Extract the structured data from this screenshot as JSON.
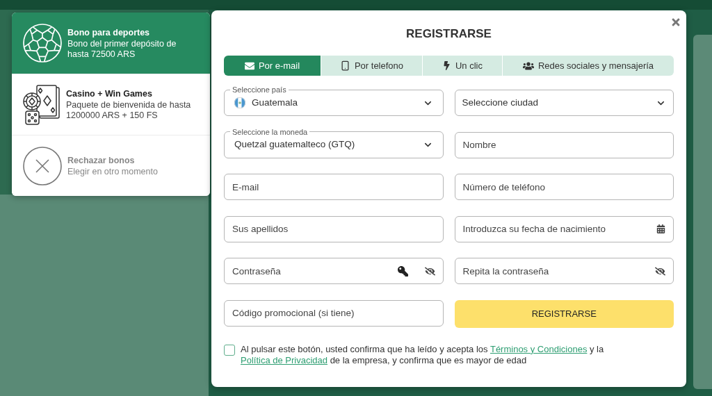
{
  "bonus_panel": {
    "items": [
      {
        "kind": "sports",
        "title": "Bono para deportes",
        "description": "Bono del primer depósito de hasta 72500 ARS",
        "selected": true
      },
      {
        "kind": "casino",
        "title": "Casino + Win Games",
        "description": "Paquete de bienvenida de hasta 1200000 ARS + 150 FS",
        "selected": false
      },
      {
        "kind": "decline",
        "title": "Rechazar bonos",
        "description": "Elegir en otro momento",
        "selected": false
      }
    ]
  },
  "dialog": {
    "title": "REGISTRARSE",
    "tabs": [
      {
        "kind": "email",
        "label": "Por e-mail",
        "selected": true
      },
      {
        "kind": "phone",
        "label": "Por telefono",
        "selected": false
      },
      {
        "kind": "one_click",
        "label": "Un clic",
        "selected": false
      },
      {
        "kind": "social",
        "label": "Redes sociales y mensajería",
        "selected": false
      }
    ],
    "fields": [
      {
        "kind": "select",
        "label": "Seleccione país",
        "value": "Guatemala",
        "flag": true
      },
      {
        "kind": "select",
        "placeholder": "Seleccione ciudad"
      },
      {
        "kind": "select",
        "label": "Seleccione la moneda",
        "value": "Quetzal guatemalteco (GTQ)"
      },
      {
        "kind": "input",
        "placeholder": "Nombre"
      },
      {
        "kind": "input",
        "placeholder": "E-mail"
      },
      {
        "kind": "input",
        "placeholder": "Número de teléfono"
      },
      {
        "kind": "input",
        "placeholder": "Sus apellidos"
      },
      {
        "kind": "date",
        "placeholder": "Introduzca su fecha de nacimiento"
      },
      {
        "kind": "password",
        "placeholder": "Contraseña",
        "generator": true
      },
      {
        "kind": "password",
        "placeholder": "Repita la contraseña",
        "generator": false
      },
      {
        "kind": "input",
        "placeholder": "Código promocional (si tiene)"
      },
      {
        "kind": "button",
        "label": "REGISTRARSE"
      }
    ],
    "consent": {
      "checked": false,
      "parts": [
        {
          "kind": "text",
          "text": "Al pulsar este botón, usted confirma que ha leído y acepta los "
        },
        {
          "kind": "link",
          "text": "Términos y Condiciones"
        },
        {
          "kind": "text",
          "text": " y la "
        },
        {
          "kind": "link",
          "text": "Política de Privacidad"
        },
        {
          "kind": "text",
          "text": " de la empresa, y confirma que es mayor de edad"
        }
      ]
    }
  }
}
